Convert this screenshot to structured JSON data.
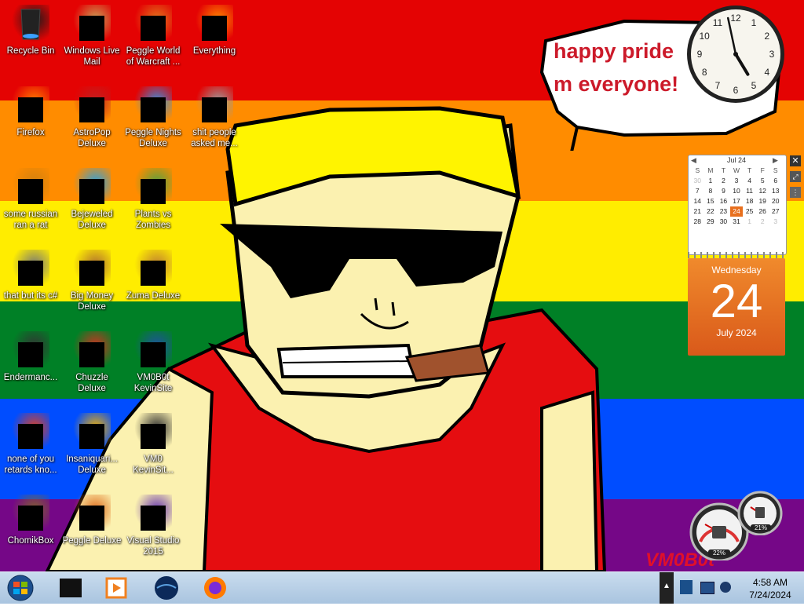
{
  "desktop": {
    "icons": [
      {
        "label": "Recycle Bin"
      },
      {
        "label": "Windows Live Mail"
      },
      {
        "label": "Peggle World of Warcraft ..."
      },
      {
        "label": "Everything"
      },
      {
        "label": "Firefox"
      },
      {
        "label": "AstroPop Deluxe"
      },
      {
        "label": "Peggle Nights Deluxe"
      },
      {
        "label": "shit people asked me..."
      },
      {
        "label": "some russian ran a rat"
      },
      {
        "label": "Bejeweled Deluxe"
      },
      {
        "label": "Plants vs Zombies"
      },
      {
        "label": "that but its c#"
      },
      {
        "label": "Big Money Deluxe"
      },
      {
        "label": "Zuma Deluxe"
      },
      {
        "label": "Endermanc..."
      },
      {
        "label": "Chuzzle Deluxe"
      },
      {
        "label": "VM0B0t KevinSite"
      },
      {
        "label": "none of you retards kno..."
      },
      {
        "label": "Insaniquari... Deluxe"
      },
      {
        "label": "VM0 KevinSit..."
      },
      {
        "label": "ChomikBox"
      },
      {
        "label": "Peggle Deluxe"
      },
      {
        "label": "Visual Studio 2015"
      }
    ]
  },
  "wallpaper": {
    "speech_bubble_text": "happy pride m everyone!",
    "signature": "VM0B0t",
    "stripe_colors": [
      "#e40303",
      "#ff8c00",
      "#ffed00",
      "#008026",
      "#004dff",
      "#750787"
    ]
  },
  "calendar_gadget": {
    "month_header": "Jul 24",
    "day_headers": [
      "S",
      "M",
      "T",
      "W",
      "T",
      "F",
      "S"
    ],
    "weeks": [
      [
        "30",
        "1",
        "2",
        "3",
        "4",
        "5",
        "6"
      ],
      [
        "7",
        "8",
        "9",
        "10",
        "11",
        "12",
        "13"
      ],
      [
        "14",
        "15",
        "16",
        "17",
        "18",
        "19",
        "20"
      ],
      [
        "21",
        "22",
        "23",
        "24",
        "25",
        "26",
        "27"
      ],
      [
        "28",
        "29",
        "30",
        "31",
        "1",
        "2",
        "3"
      ]
    ],
    "today": "24",
    "weekday": "Wednesday",
    "day": "24",
    "month_year": "July 2024"
  },
  "cpu_gadget": {
    "cpu_percent": "22%",
    "memory_percent": "21%"
  },
  "clock_gadget": {
    "hour": 4,
    "minute": 58,
    "numbers": [
      "12",
      "1",
      "2",
      "3",
      "4",
      "5",
      "6",
      "7",
      "8",
      "9",
      "10",
      "11"
    ]
  },
  "taskbar": {
    "pinned": [
      "start-orb",
      "explorer",
      "media-player",
      "network",
      "firefox"
    ],
    "tray_time": "4:58 AM",
    "tray_date": "7/24/2024"
  },
  "colors": {
    "accent_orange": "#e8701e",
    "taskbar": "#b7cde4"
  }
}
